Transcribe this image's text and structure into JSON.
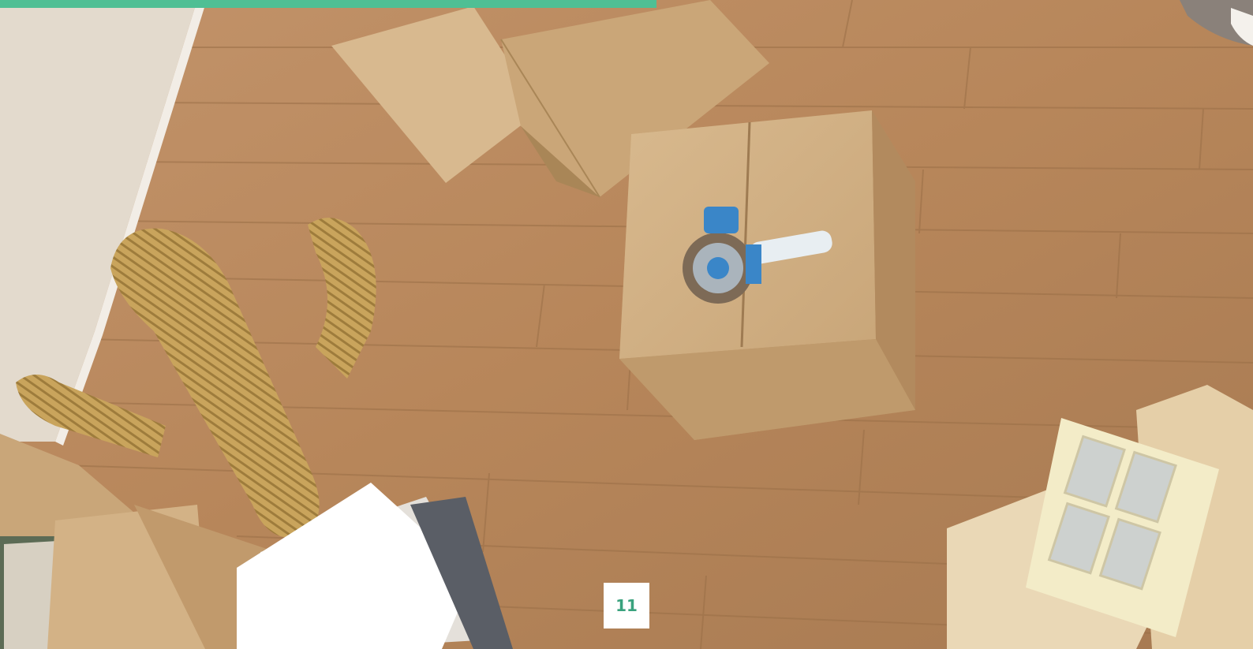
{
  "progress": {
    "fraction": 0.524
  },
  "page_number": "11",
  "colors": {
    "accent": "#4fbf94",
    "badge_text": "#3aa27e",
    "badge_bg": "#ffffff"
  }
}
